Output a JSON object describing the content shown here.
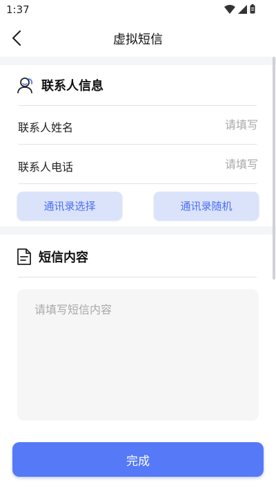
{
  "status_bar": {
    "time": "1:37",
    "icons": [
      "wifi-icon",
      "cellular-signal-icon",
      "battery-icon"
    ]
  },
  "nav": {
    "title": "虚拟短信",
    "back_icon": "back-arrow-icon"
  },
  "contact_section": {
    "icon": "contacts-icon",
    "title": "联系人信息",
    "name_label": "联系人姓名",
    "name_placeholder": "请填写",
    "phone_label": "联系人电话",
    "phone_placeholder": "请填写",
    "select_button": "通讯录选择",
    "random_button": "通讯录随机"
  },
  "sms_section": {
    "icon": "document-icon",
    "title": "短信内容",
    "content_placeholder": "请填写短信内容"
  },
  "footer": {
    "done_button": "完成"
  },
  "colors": {
    "accent": "#5579f7",
    "pill_bg": "#dbe3fb",
    "pill_text": "#4a6ef5",
    "band": "#f4f5f7"
  }
}
